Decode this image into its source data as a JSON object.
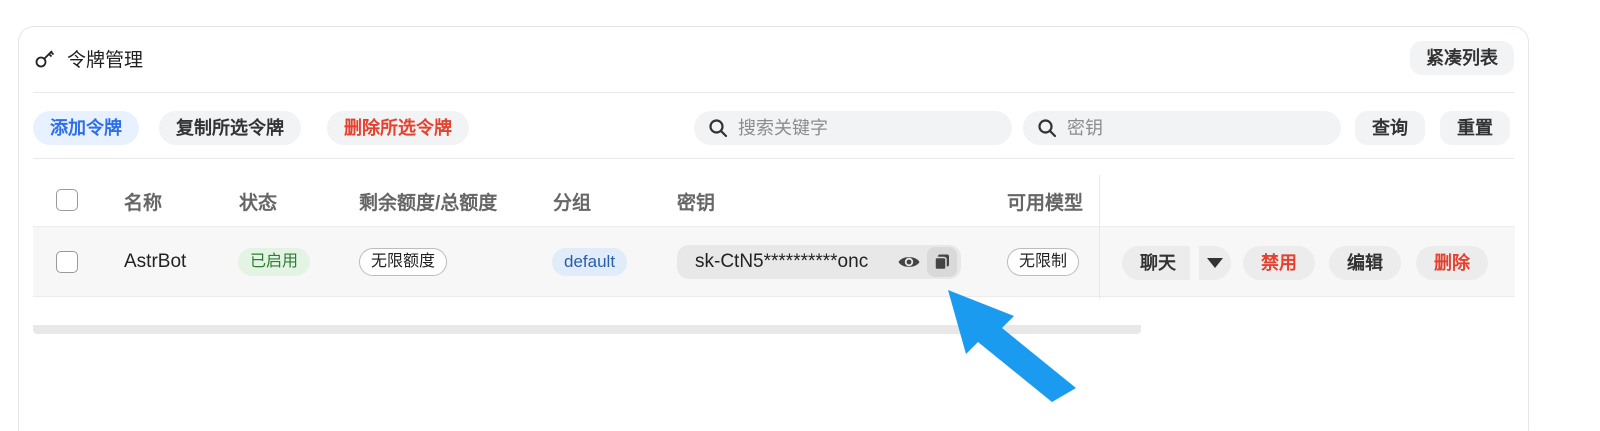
{
  "header": {
    "title": "令牌管理",
    "compact_label": "紧凑列表"
  },
  "toolbar": {
    "add_label": "添加令牌",
    "copy_selected_label": "复制所选令牌",
    "delete_selected_label": "删除所选令牌",
    "keyword_placeholder": "搜索关键字",
    "key_placeholder": "密钥",
    "query_label": "查询",
    "reset_label": "重置"
  },
  "table": {
    "columns": {
      "name": "名称",
      "status": "状态",
      "quota": "剩余额度/总额度",
      "group": "分组",
      "key": "密钥",
      "models": "可用模型"
    },
    "rows": [
      {
        "name": "AstrBot",
        "status": "已启用",
        "quota": "无限额度",
        "group": "default",
        "key": "sk-CtN5**********onc",
        "models": "无限制",
        "actions": {
          "chat": "聊天",
          "disable": "禁用",
          "edit": "编辑",
          "delete": "删除"
        }
      }
    ]
  },
  "colors": {
    "accent_blue": "#2e6fe8",
    "danger_red": "#e4412f",
    "success_green": "#2e7d32",
    "annotation_arrow": "#1a9bf0"
  },
  "icons": [
    "key-icon",
    "search-icon",
    "eye-icon",
    "copy-icon",
    "caret-down-icon",
    "annotation-arrow"
  ]
}
